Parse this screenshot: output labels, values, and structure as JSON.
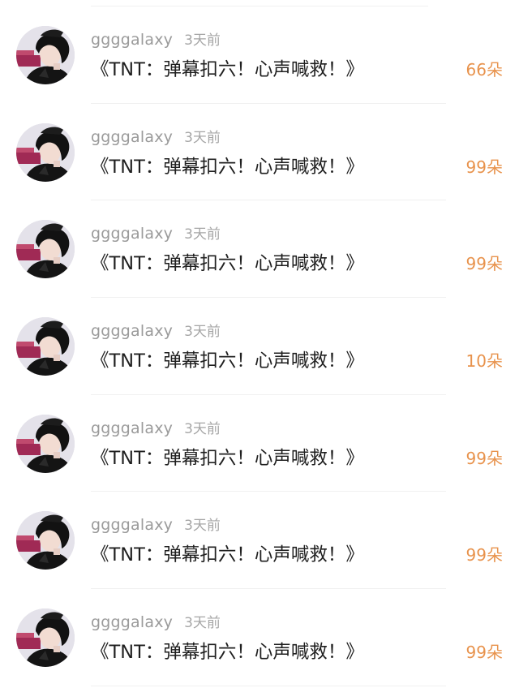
{
  "rows": [
    {
      "username": "ggggalaxy",
      "time": "3天前",
      "message": "《TNT：弹幕扣六！心声喊救！》",
      "count": "66朵",
      "avatar_icon": "user-avatar"
    },
    {
      "username": "ggggalaxy",
      "time": "3天前",
      "message": "《TNT：弹幕扣六！心声喊救！》",
      "count": "99朵",
      "avatar_icon": "user-avatar"
    },
    {
      "username": "ggggalaxy",
      "time": "3天前",
      "message": "《TNT：弹幕扣六！心声喊救！》",
      "count": "99朵",
      "avatar_icon": "user-avatar"
    },
    {
      "username": "ggggalaxy",
      "time": "3天前",
      "message": "《TNT：弹幕扣六！心声喊救！》",
      "count": "10朵",
      "avatar_icon": "user-avatar"
    },
    {
      "username": "ggggalaxy",
      "time": "3天前",
      "message": "《TNT：弹幕扣六！心声喊救！》",
      "count": "99朵",
      "avatar_icon": "user-avatar"
    },
    {
      "username": "ggggalaxy",
      "time": "3天前",
      "message": "《TNT：弹幕扣六！心声喊救！》",
      "count": "99朵",
      "avatar_icon": "user-avatar"
    },
    {
      "username": "ggggalaxy",
      "time": "3天前",
      "message": "《TNT：弹幕扣六！心声喊救！》",
      "count": "99朵",
      "avatar_icon": "user-avatar"
    }
  ],
  "colors": {
    "username": "#9a9a9a",
    "time": "#a6a6a6",
    "message": "#1f1f1f",
    "count": "#e8934d",
    "divider": "#f0f0f0"
  }
}
